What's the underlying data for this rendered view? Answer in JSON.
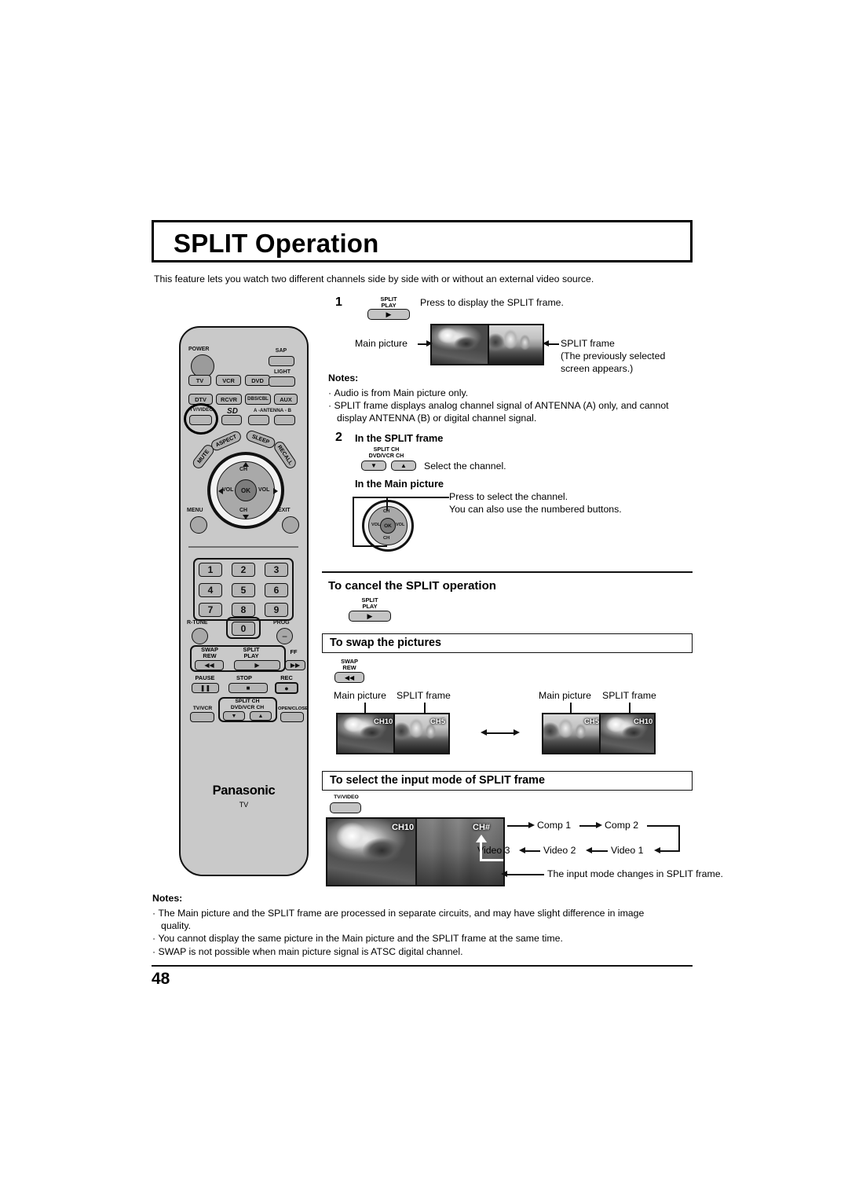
{
  "page": {
    "title": "SPLIT Operation",
    "intro": "This feature lets you watch two different channels side by side with or without an external video source.",
    "page_number": "48"
  },
  "remote": {
    "brand": "Panasonic",
    "brand_sub": "TV",
    "power_label": "POWER",
    "sap_label": "SAP",
    "light_label": "LIGHT",
    "device_row": [
      "TV",
      "VCR",
      "DVD"
    ],
    "device_row2": [
      "DTV",
      "RCVR",
      "DBS/CBL",
      "AUX"
    ],
    "tvvideo_label": "TV/VIDEO",
    "sd_label": "SD",
    "antenna_label": "A -ANTENNA - B",
    "arc_buttons": [
      "MUTE",
      "ASPECT",
      "SLEEP",
      "RECALL"
    ],
    "wheel": {
      "ch_up": "CH",
      "ch_down": "CH",
      "vol_left": "VOL",
      "vol_right": "VOL",
      "ok": "OK"
    },
    "menu_label": "MENU",
    "exit_label": "EXIT",
    "keypad": [
      "1",
      "2",
      "3",
      "4",
      "5",
      "6",
      "7",
      "8",
      "9",
      "0"
    ],
    "rtune_label": "R-TUNE",
    "prog_label": "PROG",
    "swap_rew_label": "SWAP\nREW",
    "split_play_label": "SPLIT\nPLAY",
    "ff_label": "FF",
    "pause_label": "PAUSE",
    "stop_label": "STOP",
    "rec_label": "REC",
    "tvvcr_label": "TV/VCR",
    "split_ch_label": "SPLIT CH\nDVD/VCR CH",
    "openclose_label": "OPEN/CLOSE"
  },
  "step1": {
    "number": "1",
    "button_label": "SPLIT\nPLAY",
    "instruction": "Press to display the SPLIT frame.",
    "main_picture_label": "Main picture",
    "split_frame_label": "SPLIT frame",
    "split_frame_note1": "(The previously selected",
    "split_frame_note2": "screen appears.)",
    "notes_heading": "Notes:",
    "notes": [
      "Audio is from Main picture only.",
      "SPLIT frame displays analog channel signal of ANTENNA (A) only, and cannot",
      "display ANTENNA (B) or digital channel signal."
    ]
  },
  "step2": {
    "number": "2",
    "in_split_frame": "In the SPLIT frame",
    "split_ch_button_label": "SPLIT CH\nDVD/VCR CH",
    "select_channel": "Select the channel.",
    "in_main_picture": "In the Main picture",
    "press_to_select": "Press to select the channel.",
    "numbered_buttons": "You can also use the numbered buttons.",
    "wheel": {
      "ch_up": "CH",
      "ch_down": "CH",
      "vol_left": "VOL",
      "vol_right": "VOL",
      "ok": "OK"
    }
  },
  "cancel_section": {
    "heading": "To cancel the SPLIT operation",
    "button_label": "SPLIT\nPLAY"
  },
  "swap_section": {
    "heading": "To swap the pictures",
    "button_label": "SWAP\nREW",
    "left_main_label": "Main picture",
    "left_split_label": "SPLIT frame",
    "right_main_label": "Main picture",
    "right_split_label": "SPLIT frame",
    "left_channels": [
      "CH10",
      "CH5"
    ],
    "right_channels": [
      "CH5",
      "CH10"
    ]
  },
  "input_section": {
    "heading": "To select the input mode of SPLIT frame",
    "button_label": "TV/VIDEO",
    "main_channel": "CH10",
    "split_channel": "CH#",
    "cycle_top": [
      "Comp 1",
      "Comp 2"
    ],
    "cycle_bottom": [
      "Video 3",
      "Video 2",
      "Video 1"
    ],
    "caption": "The input mode changes in SPLIT frame."
  },
  "bottom_notes": {
    "heading": "Notes:",
    "items": [
      "The Main picture and the SPLIT frame are processed in separate circuits, and may have slight difference in image",
      "quality.",
      "You cannot display the same picture in the Main picture and the SPLIT frame at the same time.",
      "SWAP is not possible when main picture signal is ATSC digital channel."
    ]
  },
  "colors": {
    "remote_body": "#c9c9c9",
    "button": "#b5b5b5",
    "ink": "#000000"
  }
}
